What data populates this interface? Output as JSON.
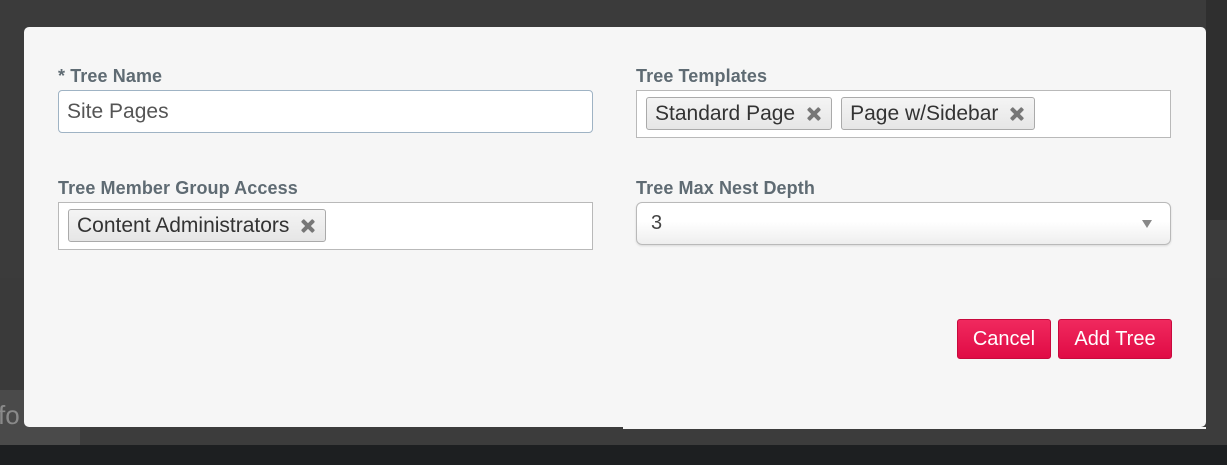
{
  "background": {
    "partial_text": "fo"
  },
  "form": {
    "tree_name": {
      "label": "* Tree Name",
      "value": "Site Pages"
    },
    "tree_templates": {
      "label": "Tree Templates",
      "tags": [
        "Standard Page",
        "Page w/Sidebar"
      ]
    },
    "member_group_access": {
      "label": "Tree Member Group Access",
      "tags": [
        "Content Administrators"
      ]
    },
    "max_nest_depth": {
      "label": "Tree Max Nest Depth",
      "selected": "3"
    }
  },
  "buttons": {
    "cancel": "Cancel",
    "add_tree": "Add Tree"
  },
  "colors": {
    "accent": "#e8134f",
    "modal_bg": "#f6f6f6",
    "label": "#5f6b73",
    "input_border": "#9fb3c4",
    "overlay": "#3b3b3b"
  },
  "icons": {
    "tag_remove": "close-x-icon",
    "select_arrow": "caret-down-icon"
  }
}
